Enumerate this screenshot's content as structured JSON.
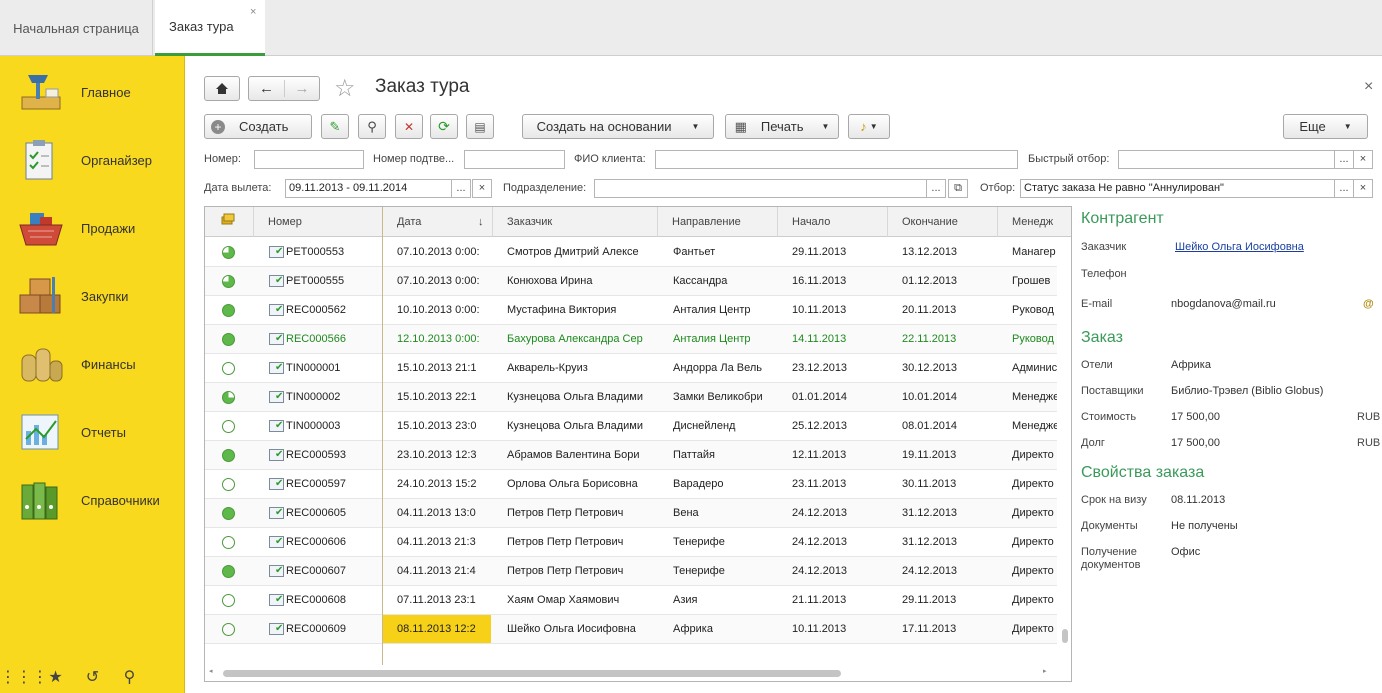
{
  "tabs": {
    "home": "Начальная страница",
    "order": "Заказ тура",
    "close": "×"
  },
  "sidebar": [
    {
      "label": "Главное",
      "icon": "lamp-icon"
    },
    {
      "label": "Органайзер",
      "icon": "clipboard-icon"
    },
    {
      "label": "Продажи",
      "icon": "basket-icon"
    },
    {
      "label": "Закупки",
      "icon": "boxes-icon"
    },
    {
      "label": "Финансы",
      "icon": "coins-icon"
    },
    {
      "label": "Отчеты",
      "icon": "report-chart-icon"
    },
    {
      "label": "Справочники",
      "icon": "binders-icon"
    }
  ],
  "sidebar_bottom": {
    "apps": "⋮⋮⋮",
    "favorites": "★",
    "history": "↺",
    "search": "⚲"
  },
  "page": {
    "title": "Заказ тура",
    "close": "×"
  },
  "toolbar": {
    "create": "Создать",
    "create_based": "Создать на основании",
    "print": "Печать",
    "more": "Еще"
  },
  "filters": {
    "number_label": "Номер:",
    "confirm_label": "Номер подтве...",
    "client_label": "ФИО клиента:",
    "quick_label": "Быстрый отбор:",
    "date_label": "Дата вылета:",
    "date_value": "09.11.2013 - 09.11.2014",
    "division_label": "Подразделение:",
    "filter_label": "Отбор:",
    "filter_value": "Статус заказа Не равно \"Аннулирован\"",
    "dots": "...",
    "clear": "×"
  },
  "table": {
    "headers": [
      "Номер",
      "Дата",
      "Заказчик",
      "Направление",
      "Начало",
      "Окончание",
      "Менедж"
    ],
    "sort_arrow": "↓",
    "rows": [
      {
        "status": "half",
        "num": "РЕТ000553",
        "date": "07.10.2013 0:00:",
        "client": "Смотров Дмитрий Алексе",
        "dir": "Фантьет",
        "start": "29.11.2013",
        "end": "13.12.2013",
        "mgr": "Манагер"
      },
      {
        "status": "half",
        "num": "РЕТ000555",
        "date": "07.10.2013 0:00:",
        "client": "Конюхова Ирина",
        "dir": "Кассандра",
        "start": "16.11.2013",
        "end": "01.12.2013",
        "mgr": "Грошев"
      },
      {
        "status": "full",
        "num": "REC000562",
        "date": "10.10.2013 0:00:",
        "client": "Мустафина Виктория",
        "dir": "Анталия Центр",
        "start": "10.11.2013",
        "end": "20.11.2013",
        "mgr": "Руковод"
      },
      {
        "status": "full",
        "num": "REC000566",
        "date": "12.10.2013 0:00:",
        "client": "Бахурова Александра Сер",
        "dir": "Анталия Центр",
        "start": "14.11.2013",
        "end": "22.11.2013",
        "mgr": "Руковод",
        "green": true
      },
      {
        "status": "empty",
        "num": "TIN000001",
        "date": "15.10.2013 21:1",
        "client": "Акварель-Круиз",
        "dir": "Андорра Ла Вель",
        "start": "23.12.2013",
        "end": "30.12.2013",
        "mgr": "Админис"
      },
      {
        "status": "quarter",
        "num": "TIN000002",
        "date": "15.10.2013 22:1",
        "client": "Кузнецова Ольга Владими",
        "dir": "Замки Великобри",
        "start": "01.01.2014",
        "end": "10.01.2014",
        "mgr": "Менедже"
      },
      {
        "status": "empty",
        "num": "TIN000003",
        "date": "15.10.2013 23:0",
        "client": "Кузнецова Ольга Владими",
        "dir": "Диснейленд",
        "start": "25.12.2013",
        "end": "08.01.2014",
        "mgr": "Менедже"
      },
      {
        "status": "full",
        "num": "REC000593",
        "date": "23.10.2013 12:3",
        "client": "Абрамов Валентина Бори",
        "dir": "Паттайя",
        "start": "12.11.2013",
        "end": "19.11.2013",
        "mgr": "Директо"
      },
      {
        "status": "empty",
        "num": "REC000597",
        "date": "24.10.2013 15:2",
        "client": "Орлова Ольга Борисовна",
        "dir": "Варадеро",
        "start": "23.11.2013",
        "end": "30.11.2013",
        "mgr": "Директо"
      },
      {
        "status": "full",
        "num": "REC000605",
        "date": "04.11.2013 13:0",
        "client": "Петров Петр Петрович",
        "dir": "Вена",
        "start": "24.12.2013",
        "end": "31.12.2013",
        "mgr": "Директо"
      },
      {
        "status": "empty",
        "num": "REC000606",
        "date": "04.11.2013 21:3",
        "client": "Петров Петр Петрович",
        "dir": "Тенерифе",
        "start": "24.12.2013",
        "end": "31.12.2013",
        "mgr": "Директо"
      },
      {
        "status": "full",
        "num": "REC000607",
        "date": "04.11.2013 21:4",
        "client": "Петров Петр Петрович",
        "dir": "Тенерифе",
        "start": "24.12.2013",
        "end": "24.12.2013",
        "mgr": "Директо"
      },
      {
        "status": "empty",
        "num": "REC000608",
        "date": "07.11.2013 23:1",
        "client": "Хаям Омар Хаямович",
        "dir": "Азия",
        "start": "21.11.2013",
        "end": "29.11.2013",
        "mgr": "Директо"
      },
      {
        "status": "empty",
        "num": "REC000609",
        "date": "08.11.2013 12:2",
        "client": "Шейко Ольга Иосифовна",
        "dir": "Африка",
        "start": "10.11.2013",
        "end": "17.11.2013",
        "mgr": "Директо",
        "selected": true
      }
    ]
  },
  "details": {
    "counterparty_head": "Контрагент",
    "customer_label": "Заказчик",
    "customer_value": "Шейко Ольга Иосифовна",
    "phone_label": "Телефон",
    "email_label": "E-mail",
    "email_value": "nbogdanova@mail.ru",
    "email_icon": "@",
    "order_head": "Заказ",
    "hotels_label": "Отели",
    "hotels_value": "Африка",
    "suppliers_label": "Поставщики",
    "suppliers_value": "Библио-Трэвел (Biblio Globus)",
    "cost_label": "Стоимость",
    "cost_value": "17 500,00",
    "cost_cur": "RUB",
    "debt_label": "Долг",
    "debt_value": "17 500,00",
    "debt_cur": "RUB",
    "props_head": "Свойства заказа",
    "visa_label": "Срок на визу",
    "visa_value": "08.11.2013",
    "docs_label": "Документы",
    "docs_value": "Не получены",
    "docs_get_label1": "Получение",
    "docs_get_label2": "документов",
    "docs_get_value": "Офис"
  },
  "colors": {
    "sidebar": "#f9d91e",
    "accent_green": "#3a9a5a",
    "selected_cell": "#f7d117"
  }
}
